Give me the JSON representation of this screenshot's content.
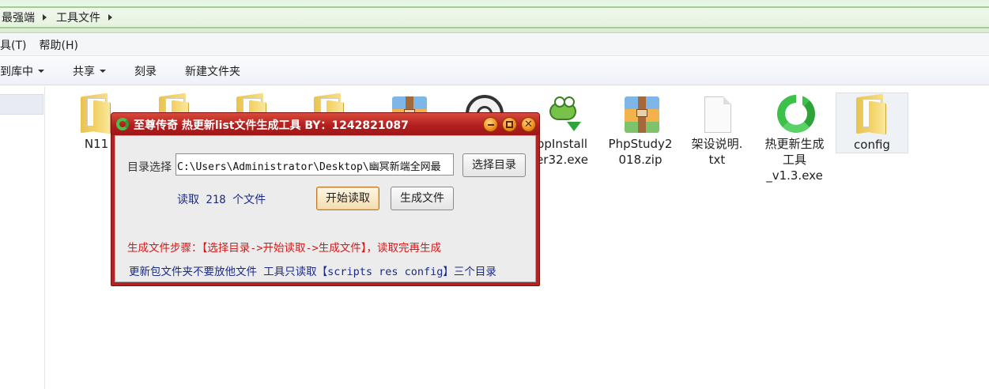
{
  "address": {
    "crumbs": [
      "最强端",
      "工具文件"
    ]
  },
  "menu": {
    "items": [
      "具(T)",
      "帮助(H)"
    ]
  },
  "toolbar": {
    "items": [
      {
        "label": "到库中",
        "caret": true
      },
      {
        "label": "共享",
        "caret": true
      },
      {
        "label": "刻录",
        "caret": false
      },
      {
        "label": "新建文件夹",
        "caret": false
      }
    ]
  },
  "files": [
    {
      "name": "N11",
      "icon": "folder-icon"
    },
    {
      "name": "",
      "icon": "folder-icon"
    },
    {
      "name": "",
      "icon": "folder-icon"
    },
    {
      "name": "",
      "icon": "folder-icon"
    },
    {
      "name": "",
      "icon": "archive-icon"
    },
    {
      "name": "",
      "icon": "php-icon"
    },
    {
      "name_line1": "ppInstall",
      "name_line2": "er32.exe",
      "icon": "gecko-installer-icon"
    },
    {
      "name_line1": "PhpStudy2",
      "name_line2": "018.zip",
      "icon": "archive-icon"
    },
    {
      "name_line1": "架设说明.",
      "name_line2": "txt",
      "icon": "text-file-icon"
    },
    {
      "name_line1": "热更新生成",
      "name_line2": "工具",
      "name_line3": "_v1.3.exe",
      "icon": "recycle-icon"
    },
    {
      "name": "config",
      "icon": "folder-icon"
    }
  ],
  "dialog": {
    "title": "至尊传奇 热更新list文件生成工具 BY：1242821087",
    "dir_label": "目录选择",
    "path_value": "C:\\Users\\Administrator\\Desktop\\幽冥新端全网最",
    "select_button": "选择目录",
    "count_text": "读取 218 个文件",
    "start_button": "开始读取",
    "generate_button": "生成文件",
    "steps_text": "生成文件步骤：【选择目录->开始读取->生成文件】，读取完再生成",
    "note_text": "更新包文件夹不要放他文件 工具只读取【scripts res config】三个目录"
  },
  "colors": {
    "dialog_frame": "#b02424",
    "steps_text": "#d21a1a",
    "info_text": "#1a2a8c",
    "addressbar_green": "#9fcf92"
  }
}
